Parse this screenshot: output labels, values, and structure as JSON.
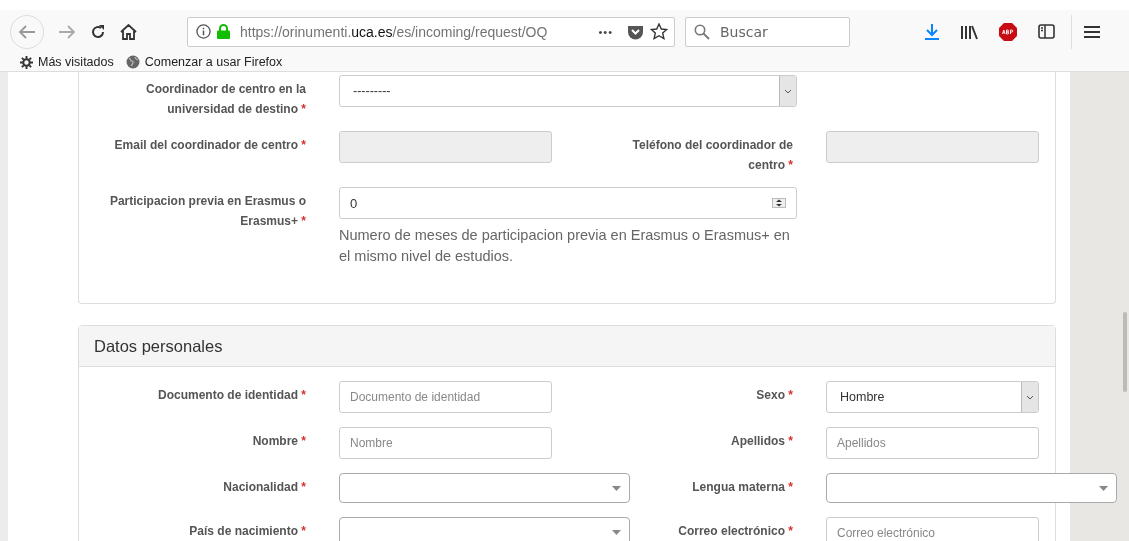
{
  "browser": {
    "url_host_prefix": "https://orinumenti.",
    "url_host": "uca.es",
    "url_path": "/es/incoming/request/OQ",
    "search": {
      "placeholder": "Buscar"
    },
    "ellipsis": "•••",
    "bookmarks": [
      {
        "kind": "gear",
        "label": "Más visitados"
      },
      {
        "kind": "globe",
        "label": "Comenzar a usar Firefox"
      }
    ]
  },
  "sections": [
    {
      "rows": [
        {
          "cells": [
            {
              "label": "Coordinador de centro en la universidad de destino",
              "required_mark": "*",
              "field": {
                "kind": "select",
                "value": "---------"
              }
            }
          ]
        },
        {
          "cells": [
            {
              "label": "Email del coordinador de centro",
              "required_mark": "*",
              "field": {
                "kind": "readonly"
              }
            },
            {
              "label": "Teléfono del coordinador de centro",
              "required_mark": "*",
              "field": {
                "kind": "readonly"
              }
            }
          ]
        },
        {
          "cells": [
            {
              "label": "Participacion previa en Erasmus o Erasmus+",
              "required_mark": "*",
              "field": {
                "kind": "number",
                "value": "0",
                "help": "Numero de meses de participacion previa en Erasmus o Erasmus+ en el mismo nivel de estudios."
              }
            }
          ]
        }
      ]
    },
    {
      "title": "Datos personales",
      "rows": [
        {
          "cells": [
            {
              "label": "Documento de identidad",
              "required_mark": "*",
              "field": {
                "kind": "text",
                "placeholder": "Documento de identidad"
              }
            },
            {
              "label": "Sexo",
              "required_mark": "*",
              "field": {
                "kind": "select",
                "value": "Hombre"
              }
            }
          ]
        },
        {
          "cells": [
            {
              "label": "Nombre",
              "required_mark": "*",
              "field": {
                "kind": "text",
                "placeholder": "Nombre"
              }
            },
            {
              "label": "Apellidos",
              "required_mark": "*",
              "field": {
                "kind": "text",
                "placeholder": "Apellidos"
              }
            }
          ]
        },
        {
          "cells": [
            {
              "label": "Nacionalidad",
              "required_mark": "*",
              "field": {
                "kind": "combo"
              }
            },
            {
              "label": "Lengua materna",
              "required_mark": "*",
              "field": {
                "kind": "combo"
              }
            }
          ]
        },
        {
          "cells": [
            {
              "label": "País de nacimiento",
              "required_mark": "*",
              "field": {
                "kind": "combo"
              }
            },
            {
              "label": "Correo electrónico",
              "required_mark": "*",
              "field": {
                "kind": "text",
                "placeholder": "Correo electrónico"
              }
            }
          ]
        }
      ]
    }
  ]
}
